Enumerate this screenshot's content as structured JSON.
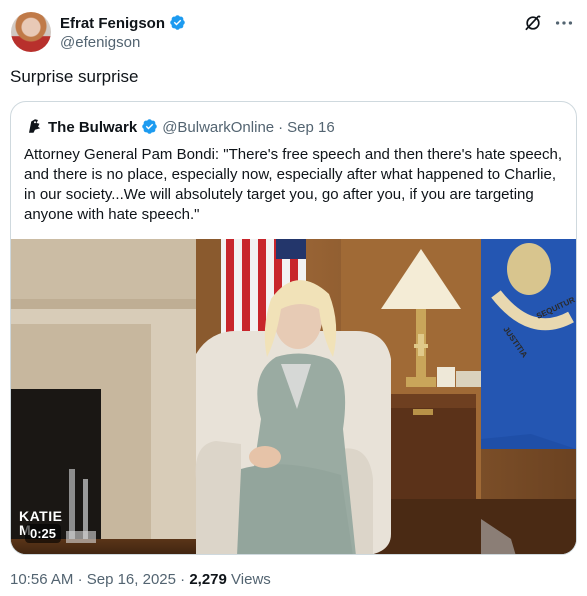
{
  "post": {
    "author_name": "Efrat Fenigson",
    "author_handle": "@efenigson",
    "text": "Surprise surprise"
  },
  "quote": {
    "author_name": "The Bulwark",
    "author_handle": "@BulwarkOnline",
    "separator": "·",
    "date": "Sep 16",
    "text": "Attorney General Pam Bondi: \"There's free speech and then there's hate speech, and there is no place, especially now, especially after what happened to Charlie, in our society...We will absolutely target you, go after you, if you are targeting anyone with hate speech.\""
  },
  "video": {
    "watermark_line1": "KATIE",
    "watermark_line2": "M",
    "duration": "0:25",
    "flag_text_1": "JUSTITIA",
    "flag_text_2": "SEQUITUR"
  },
  "footer": {
    "time": "10:56 AM",
    "date": "Sep 16, 2025",
    "separator": "·",
    "views_count": "2,279",
    "views_label": "Views"
  },
  "colors": {
    "verified": "#1d9bf0",
    "muted_text": "#536471",
    "border": "#cfd9de"
  },
  "icons": [
    "verified-badge-icon",
    "grok-icon",
    "more-icon",
    "bulwark-logo-icon"
  ]
}
